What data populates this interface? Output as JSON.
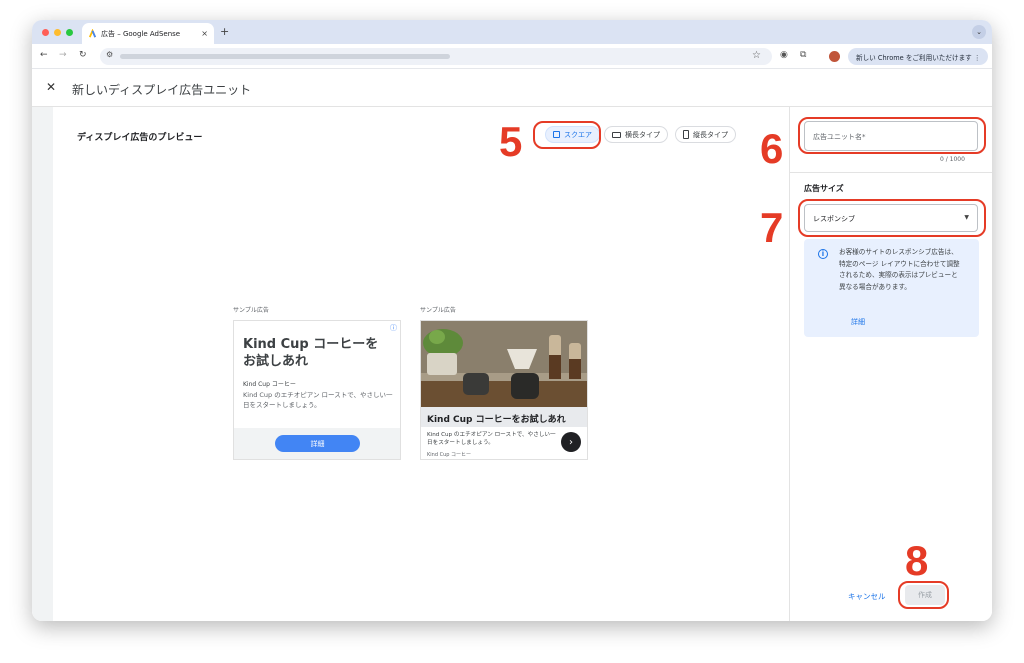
{
  "browser": {
    "tab_title": "広告 – Google AdSense",
    "tab_close": "×",
    "new_tab": "+",
    "profile_pill": "新しい Chrome をご利用いただけます ⋮"
  },
  "page": {
    "title": "新しいディスプレイ広告ユニット",
    "close": "✕"
  },
  "preview": {
    "title": "ディスプレイ広告のプレビュー",
    "shapes": [
      {
        "label": "スクエア",
        "active": true
      },
      {
        "label": "横長タイプ",
        "active": false
      },
      {
        "label": "縦長タイプ",
        "active": false
      }
    ]
  },
  "ads": {
    "label": "サンプル広告",
    "ad1": {
      "headline": "Kind Cup コーヒーを お試しあれ",
      "brand": "Kind Cup コーヒー",
      "body": "Kind Cup のエチオピアン ローストで、やさしい一日をスタートしましょう。",
      "button": "詳細"
    },
    "ad2": {
      "headline": "Kind Cup コーヒーをお試しあれ",
      "body": "Kind Cup のエチオピアン ローストで、やさしい一日をスタートしましょう。",
      "brand": "Kind Cup コーヒー"
    }
  },
  "side_panel": {
    "name_placeholder": "広告ユニット名*",
    "char_count": "0 / 1000",
    "size_label": "広告サイズ",
    "size_value": "レスポンシブ",
    "info_text": "お客様のサイトのレスポンシブ広告は、特定のページ レイアウトに合わせて調整されるため、実際の表示はプレビューと異なる場合があります。",
    "info_link": "詳細",
    "cancel": "キャンセル",
    "create": "作成"
  },
  "annotations": [
    "5",
    "6",
    "7",
    "8"
  ],
  "colors": {
    "annotation_red": "#e53b26",
    "link_blue": "#1a73e8",
    "info_bg": "#e8f0fe"
  }
}
